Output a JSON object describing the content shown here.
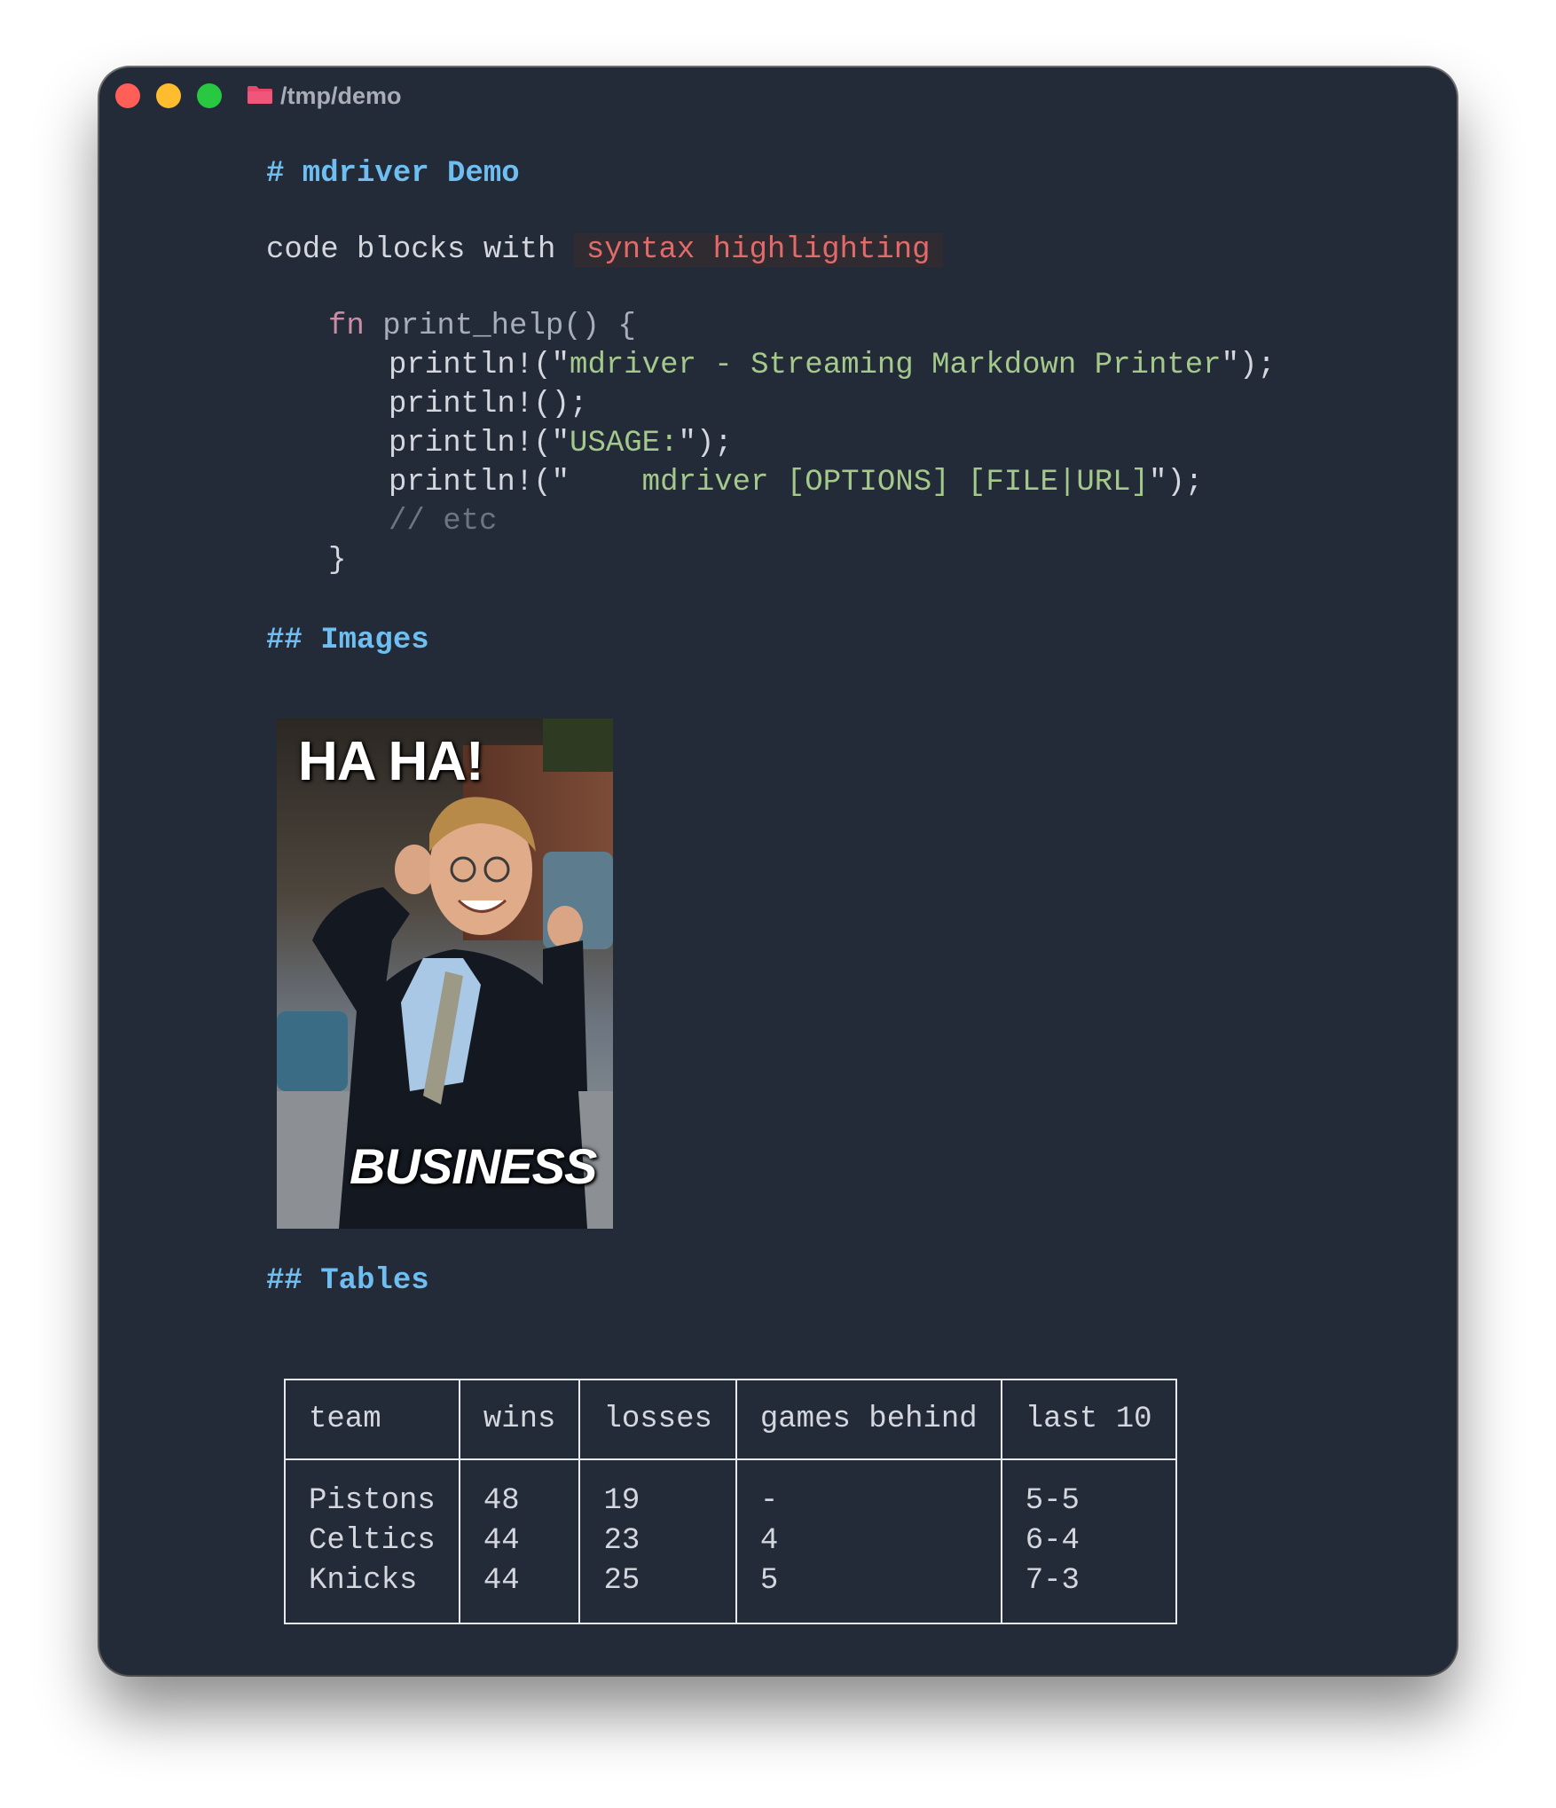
{
  "window": {
    "title": "/tmp/demo"
  },
  "doc": {
    "h1": "# mdriver Demo",
    "intro_text": "code blocks with ",
    "intro_code": "syntax highlighting",
    "code": {
      "l1_kw": "fn",
      "l1_rest": " print_help() {",
      "l2_pre": "println!(\"",
      "l2_str": "mdriver - Streaming Markdown Printer",
      "l2_post": "\");",
      "l3": "println!();",
      "l4_pre": "println!(\"",
      "l4_str": "USAGE:",
      "l4_post": "\");",
      "l5_pre": "println!(\"",
      "l5_str": "    mdriver [OPTIONS] [FILE|URL]",
      "l5_post": "\");",
      "l6_comment": "// etc",
      "l7": "}"
    },
    "h2_images": "## Images",
    "meme": {
      "top_text": "HA HA!",
      "bottom_text": "BUSINESS"
    },
    "h2_tables": "## Tables"
  },
  "table": {
    "headers": [
      "team",
      "wins",
      "losses",
      "games behind",
      "last 10"
    ],
    "rows": [
      [
        "Pistons",
        "48",
        "19",
        "-",
        "5-5"
      ],
      [
        "Celtics",
        "44",
        "23",
        "4",
        "6-4"
      ],
      [
        "Knicks",
        "44",
        "25",
        "5",
        "7-3"
      ]
    ]
  },
  "colors": {
    "background": "#232a38",
    "heading": "#6fbef2",
    "inline_code_text": "#e36a6a",
    "string": "#a4c98b",
    "keyword": "#c98ea3",
    "comment": "#6d7482"
  }
}
